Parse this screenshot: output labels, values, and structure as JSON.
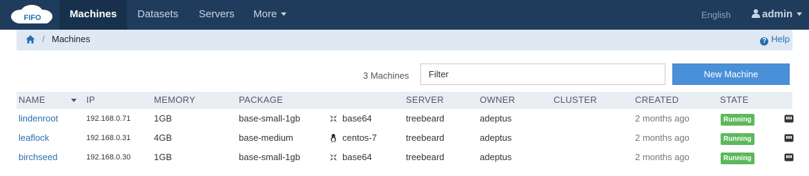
{
  "navbar": {
    "logo_text": "FIFO",
    "items": [
      {
        "label": "Machines",
        "active": true
      },
      {
        "label": "Datasets",
        "active": false
      },
      {
        "label": "Servers",
        "active": false
      },
      {
        "label": "More",
        "active": false
      }
    ],
    "language": "English",
    "user": "admin"
  },
  "breadcrumb": {
    "current": "Machines",
    "separator": "/",
    "help_label": "Help",
    "home_icon": "home-icon"
  },
  "toolbar": {
    "count_label": "3 Machines",
    "filter_placeholder": "Filter",
    "new_button_label": "New Machine"
  },
  "table": {
    "columns": [
      "NAME",
      "IP",
      "MEMORY",
      "PACKAGE",
      "SERVER",
      "OWNER",
      "CLUSTER",
      "CREATED",
      "STATE"
    ],
    "rows": [
      {
        "name": "lindenroot",
        "ip": "192.168.0.71",
        "memory": "1GB",
        "package": "base-small-1gb",
        "os_icon": "smartos-icon",
        "os": "base64",
        "server": "treebeard",
        "owner": "adeptus",
        "cluster": "",
        "created": "2 months ago",
        "state": "Running"
      },
      {
        "name": "leaflock",
        "ip": "192.168.0.31",
        "memory": "4GB",
        "package": "base-medium",
        "os_icon": "linux-icon",
        "os": "centos-7",
        "server": "treebeard",
        "owner": "adeptus",
        "cluster": "",
        "created": "2 months ago",
        "state": "Running"
      },
      {
        "name": "birchseed",
        "ip": "192.168.0.30",
        "memory": "1GB",
        "package": "base-small-1gb",
        "os_icon": "smartos-icon",
        "os": "base64",
        "server": "treebeard",
        "owner": "adeptus",
        "cluster": "",
        "created": "2 months ago",
        "state": "Running"
      }
    ]
  },
  "colors": {
    "navbar": "#1f3c5c",
    "accent": "#4a90d9",
    "running": "#5cb85c",
    "link": "#2a6eb0"
  }
}
